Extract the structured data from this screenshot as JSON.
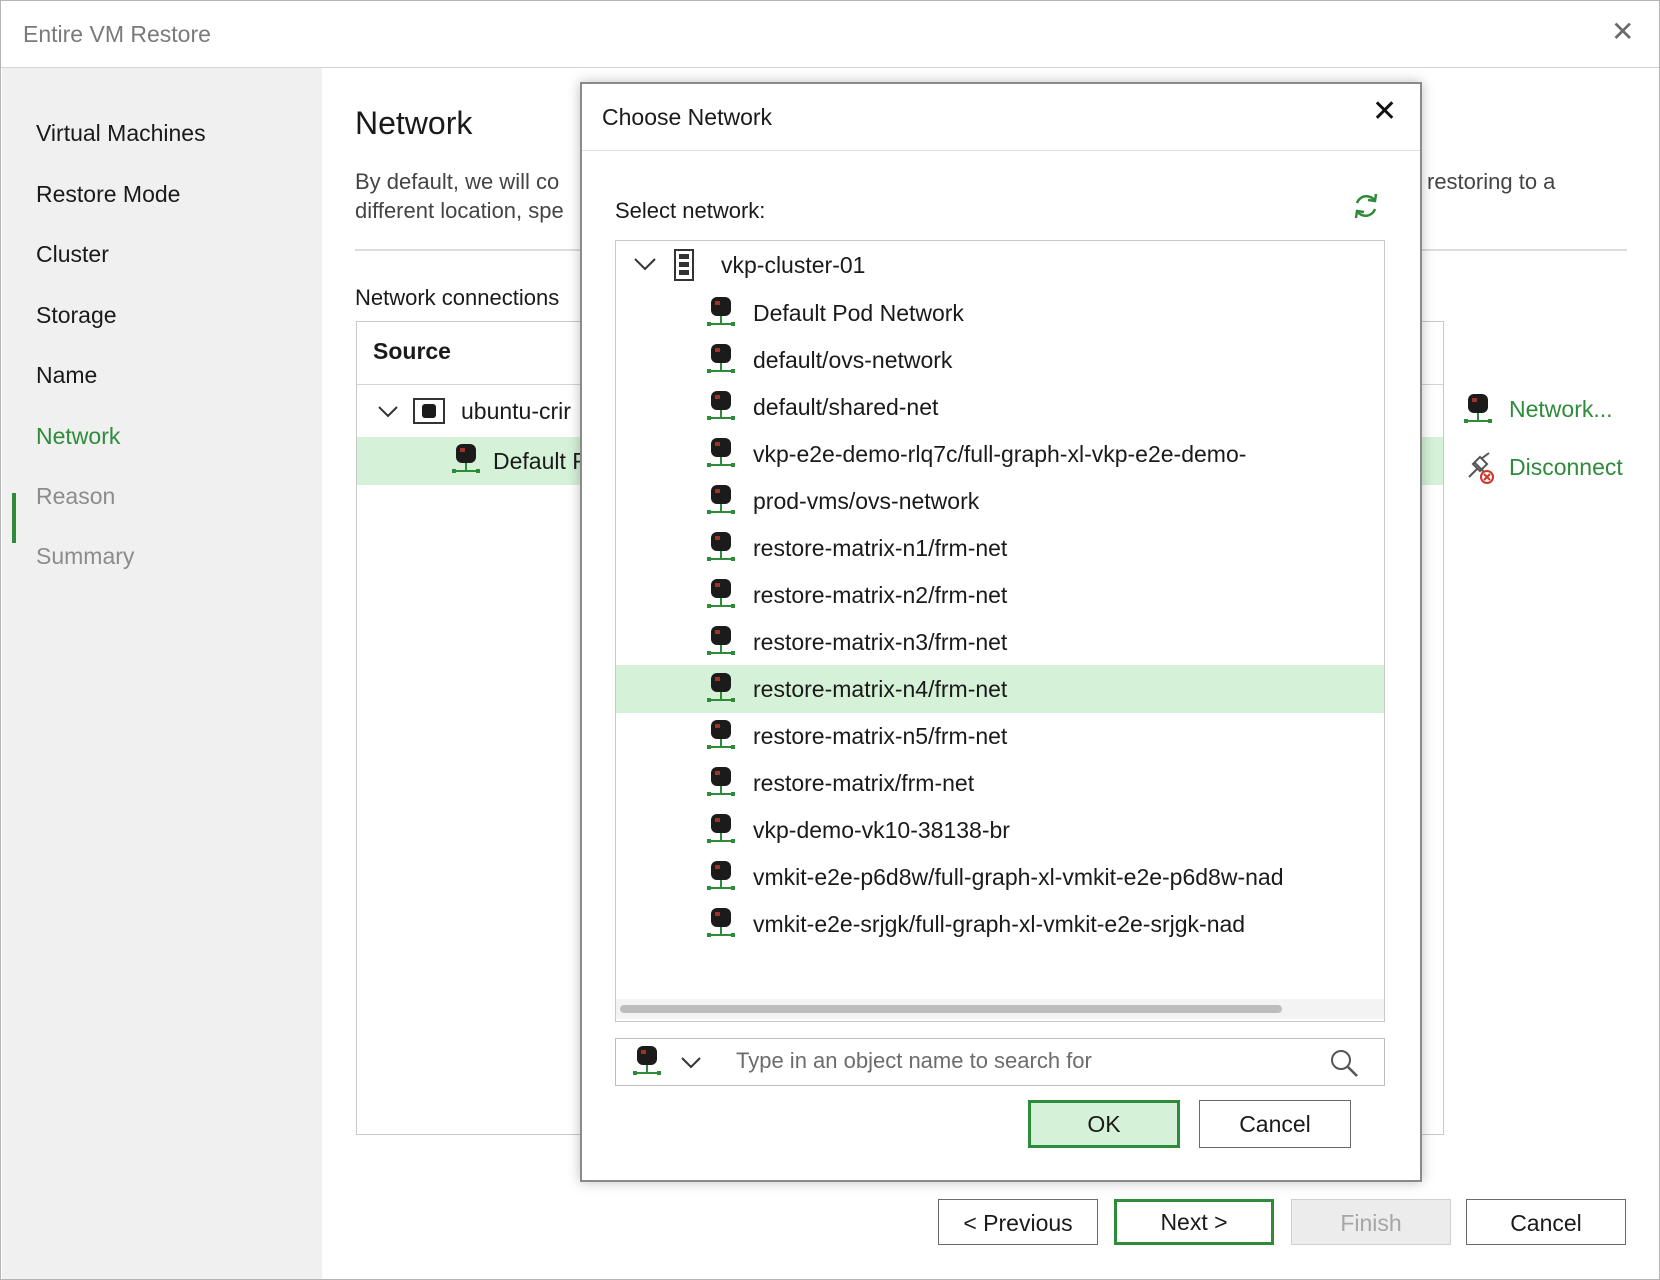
{
  "window": {
    "title": "Entire VM Restore",
    "close_glyph": "✕"
  },
  "sidebar": {
    "steps": [
      {
        "label": "Virtual Machines",
        "state": "normal"
      },
      {
        "label": "Restore Mode",
        "state": "normal"
      },
      {
        "label": "Cluster",
        "state": "normal"
      },
      {
        "label": "Storage",
        "state": "normal"
      },
      {
        "label": "Name",
        "state": "normal"
      },
      {
        "label": "Network",
        "state": "active"
      },
      {
        "label": "Reason",
        "state": "disabled"
      },
      {
        "label": "Summary",
        "state": "disabled"
      }
    ]
  },
  "main": {
    "title": "Network",
    "description_left_1": "By default, we will co",
    "description_left_2": "different location, spe",
    "description_right_1": "restoring to a",
    "network_connections_label": "Network connections",
    "table": {
      "source_header": "Source",
      "vm_name": "ubuntu-crir",
      "network_name": "Default F"
    },
    "actions": {
      "network": "Network...",
      "disconnect": "Disconnect"
    }
  },
  "footer": {
    "previous": "< Previous",
    "next": "Next >",
    "finish": "Finish",
    "cancel": "Cancel"
  },
  "dialog": {
    "title": "Choose Network",
    "close_glyph": "✕",
    "select_label": "Select network:",
    "tree": {
      "root": "vkp-cluster-01",
      "selected_index": 8,
      "items": [
        "Default Pod Network",
        "default/ovs-network",
        "default/shared-net",
        "vkp-e2e-demo-rlq7c/full-graph-xl-vkp-e2e-demo-",
        "prod-vms/ovs-network",
        "restore-matrix-n1/frm-net",
        "restore-matrix-n2/frm-net",
        "restore-matrix-n3/frm-net",
        "restore-matrix-n4/frm-net",
        "restore-matrix-n5/frm-net",
        "restore-matrix/frm-net",
        "vkp-demo-vk10-38138-br",
        "vmkit-e2e-p6d8w/full-graph-xl-vmkit-e2e-p6d8w-nad",
        "vmkit-e2e-srjgk/full-graph-xl-vmkit-e2e-srjgk-nad"
      ]
    },
    "search": {
      "placeholder": "Type in an object name to search for",
      "value": ""
    },
    "ok": "OK",
    "cancel": "Cancel"
  },
  "colors": {
    "accent": "#2e8b3a",
    "selection": "#d5f2d8",
    "sidebar_bg": "#f0f0f0"
  }
}
